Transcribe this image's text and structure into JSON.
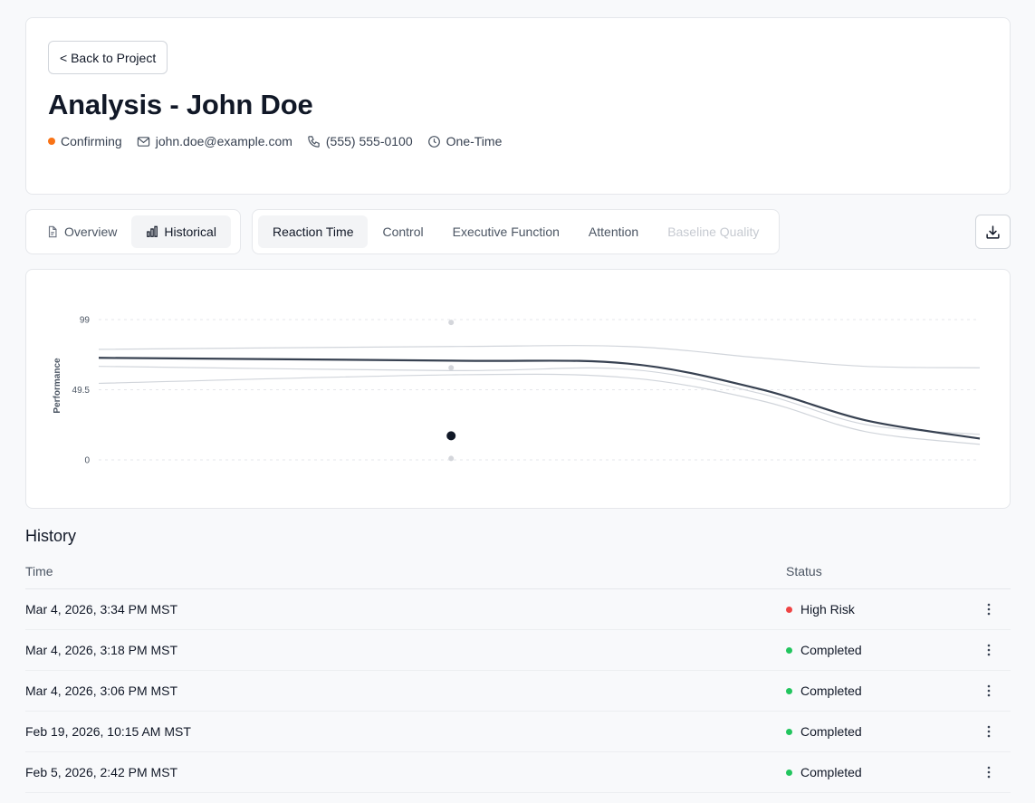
{
  "header": {
    "back_label": "< Back to Project",
    "title": "Analysis - John Doe",
    "status": "Confirming",
    "status_color": "#f97316",
    "email": "john.doe@example.com",
    "phone": "(555) 555-0100",
    "frequency": "One-Time",
    "icons": {
      "email": "mail-icon",
      "phone": "phone-icon",
      "frequency": "clock-icon"
    }
  },
  "view_tabs": [
    {
      "label": "Overview",
      "icon": "document-icon",
      "active": false
    },
    {
      "label": "Historical",
      "icon": "bar-chart-icon",
      "active": true
    }
  ],
  "metric_tabs": [
    {
      "label": "Reaction Time",
      "active": true,
      "disabled": false
    },
    {
      "label": "Control",
      "active": false,
      "disabled": false
    },
    {
      "label": "Executive Function",
      "active": false,
      "disabled": false
    },
    {
      "label": "Attention",
      "active": false,
      "disabled": false
    },
    {
      "label": "Baseline Quality",
      "active": false,
      "disabled": true
    }
  ],
  "download_icon": "download-icon",
  "chart_data": {
    "type": "line",
    "ylabel": "Performance",
    "ylim": [
      0,
      99
    ],
    "yticks": [
      0,
      49.5,
      99
    ],
    "xlim": [
      0,
      1
    ],
    "series": [
      {
        "x": [
          0,
          0.4,
          0.6,
          0.75,
          0.87,
          1.0
        ],
        "values": [
          72,
          70,
          68,
          50,
          28,
          15
        ],
        "color": "#374151",
        "width": 2.2
      },
      {
        "x": [
          0,
          0.4,
          0.6,
          0.75,
          0.87,
          1.0
        ],
        "values": [
          78,
          80,
          80,
          72,
          66,
          65
        ],
        "color": "#d1d5db",
        "width": 1.2
      },
      {
        "x": [
          0,
          0.4,
          0.6,
          0.75,
          0.87,
          1.0
        ],
        "values": [
          66,
          63,
          64,
          47,
          25,
          18
        ],
        "color": "#d1d5db",
        "width": 1.2
      },
      {
        "x": [
          0,
          0.4,
          0.6,
          0.75,
          0.87,
          1.0
        ],
        "values": [
          54,
          60,
          58,
          42,
          20,
          11
        ],
        "color": "#d1d5db",
        "width": 1.2
      }
    ],
    "points": [
      {
        "x": 0.4,
        "y": 97,
        "color": "#d4d6db",
        "r": 3
      },
      {
        "x": 0.4,
        "y": 65,
        "color": "#d4d6db",
        "r": 3
      },
      {
        "x": 0.4,
        "y": 17,
        "color": "#111827",
        "r": 5
      },
      {
        "x": 0.4,
        "y": 1,
        "color": "#d4d6db",
        "r": 3
      }
    ]
  },
  "history": {
    "title": "History",
    "columns": {
      "time": "Time",
      "status": "Status"
    },
    "menu_icon": "more-vertical-icon",
    "rows": [
      {
        "time": "Mar 4, 2026, 3:34 PM MST",
        "status": "High Risk",
        "color": "#ef4444"
      },
      {
        "time": "Mar 4, 2026, 3:18 PM MST",
        "status": "Completed",
        "color": "#22c55e"
      },
      {
        "time": "Mar 4, 2026, 3:06 PM MST",
        "status": "Completed",
        "color": "#22c55e"
      },
      {
        "time": "Feb 19, 2026, 10:15 AM MST",
        "status": "Completed",
        "color": "#22c55e"
      },
      {
        "time": "Feb 5, 2026, 2:42 PM MST",
        "status": "Completed",
        "color": "#22c55e"
      }
    ]
  }
}
